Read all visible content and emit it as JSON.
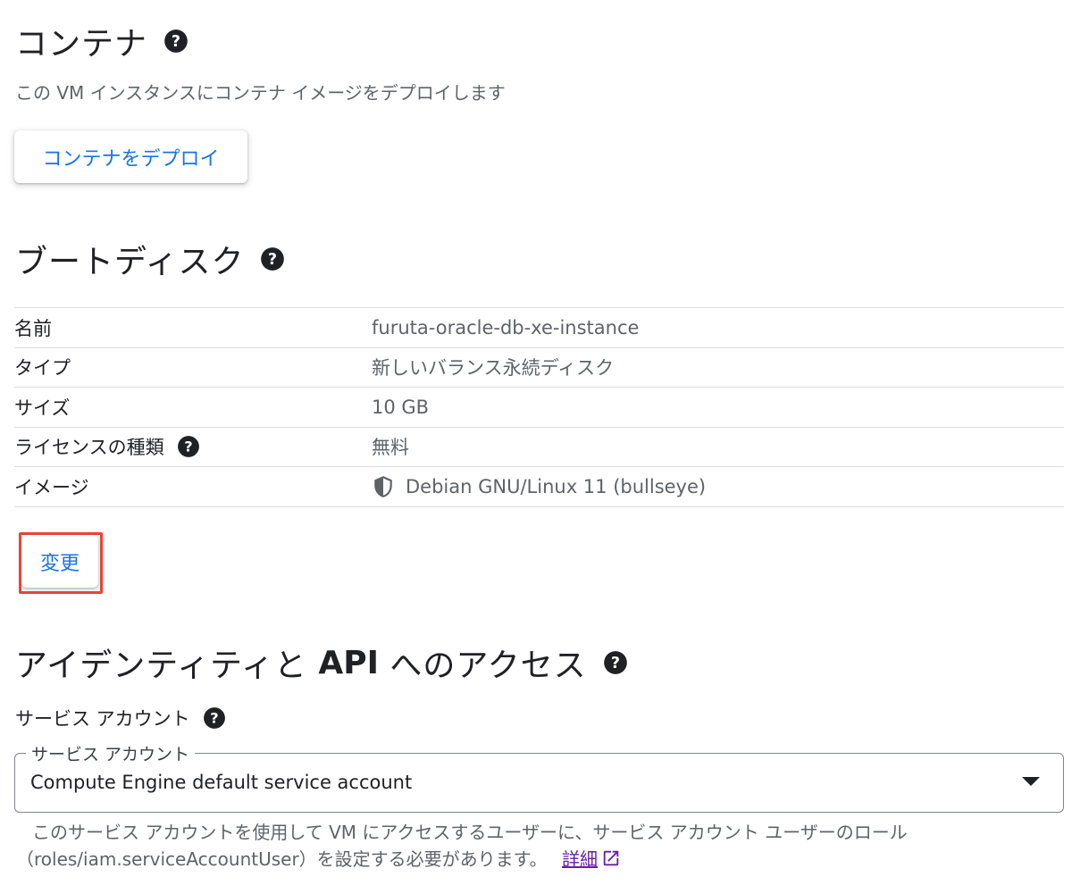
{
  "container": {
    "title": "コンテナ",
    "description": "この VM インスタンスにコンテナ イメージをデプロイします",
    "deploy_button": "コンテナをデプロイ"
  },
  "boot_disk": {
    "title": "ブートディスク",
    "rows": [
      {
        "key": "名前",
        "value": "furuta-oracle-db-xe-instance"
      },
      {
        "key": "タイプ",
        "value": "新しいバランス永続ディスク"
      },
      {
        "key": "サイズ",
        "value": "10 GB"
      },
      {
        "key": "ライセンスの種類",
        "value": "無料"
      },
      {
        "key": "イメージ",
        "value": "Debian GNU/Linux 11 (bullseye)"
      }
    ],
    "change_button": "変更"
  },
  "identity": {
    "title_prefix": "アイデンティティと ",
    "title_api": "API",
    "title_suffix": " へのアクセス",
    "service_account_label": "サービス アカウント",
    "field_legend": "サービス アカウント",
    "field_value": "Compute Engine default service account",
    "helper_line1": "このサービス アカウントを使用して VM にアクセスするユーザーに、サービス アカウント ユーザーのロール",
    "helper_line2": "（roles/iam.serviceAccountUser）を設定する必要があります。",
    "helper_link": "詳細"
  },
  "colors": {
    "link_blue": "#1a73e8",
    "highlight_red": "#ea4335",
    "link_purple": "#681da8"
  }
}
